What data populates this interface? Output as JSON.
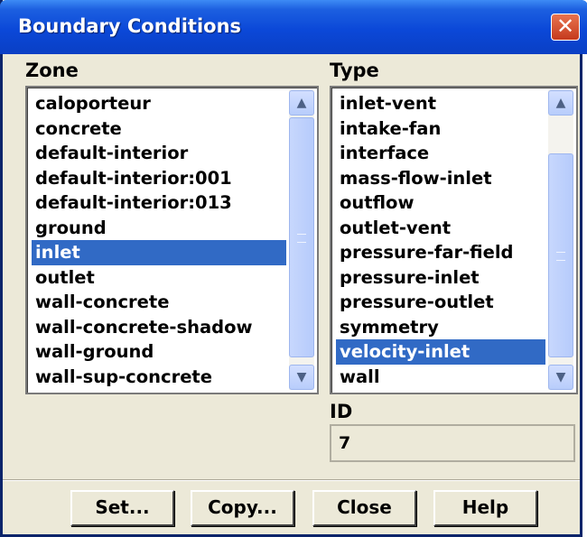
{
  "window": {
    "title": "Boundary Conditions"
  },
  "zone": {
    "label": "Zone",
    "items": [
      "caloporteur",
      "concrete",
      "default-interior",
      "default-interior:001",
      "default-interior:013",
      "ground",
      "inlet",
      "outlet",
      "wall-concrete",
      "wall-concrete-shadow",
      "wall-ground",
      "wall-sup-concrete"
    ],
    "selected": "inlet"
  },
  "type": {
    "label": "Type",
    "items": [
      "inlet-vent",
      "intake-fan",
      "interface",
      "mass-flow-inlet",
      "outflow",
      "outlet-vent",
      "pressure-far-field",
      "pressure-inlet",
      "pressure-outlet",
      "symmetry",
      "velocity-inlet",
      "wall"
    ],
    "selected": "velocity-inlet"
  },
  "id": {
    "label": "ID",
    "value": "7"
  },
  "buttons": {
    "set": "Set...",
    "copy": "Copy...",
    "close": "Close",
    "help": "Help"
  },
  "colors": {
    "titlebar": "#0b48d8",
    "selection": "#316ac5",
    "dialog_bg": "#ece9d8"
  },
  "icons": {
    "close": "close-icon",
    "scroll_up": "chevron-up-icon",
    "scroll_down": "chevron-down-icon"
  }
}
